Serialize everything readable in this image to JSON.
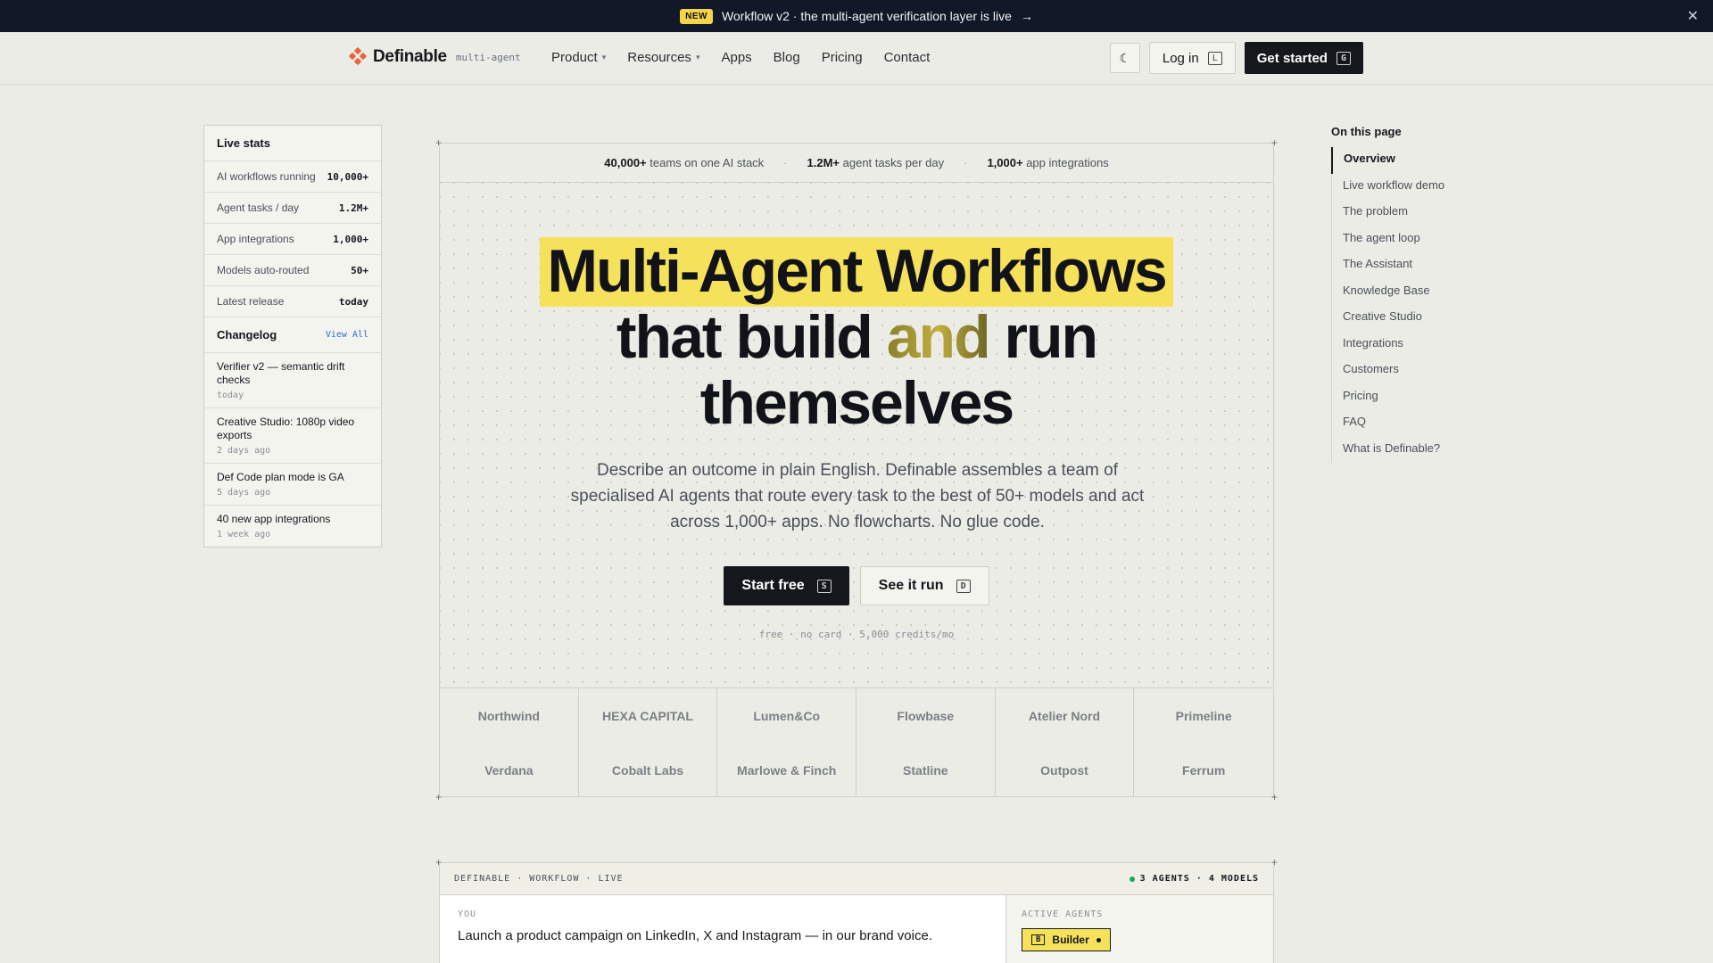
{
  "announcement": {
    "badge": "NEW",
    "text": "Workflow v2 · the multi-agent verification layer is live",
    "arrow": "→",
    "close": "✕"
  },
  "nav": {
    "brand": "Definable",
    "brand_sub": "multi-agent",
    "menu": [
      {
        "label": "Product",
        "dropdown": true
      },
      {
        "label": "Resources",
        "dropdown": true
      },
      {
        "label": "Apps"
      },
      {
        "label": "Blog"
      },
      {
        "label": "Pricing"
      },
      {
        "label": "Contact"
      }
    ],
    "theme_icon": "☾",
    "login": "Log in",
    "login_key": "L",
    "get_started": "Get started",
    "get_started_key": "G"
  },
  "stats": {
    "title": "Live stats",
    "rows": [
      {
        "label": "AI workflows running",
        "value": "10,000+"
      },
      {
        "label": "Agent tasks / day",
        "value": "1.2M+"
      },
      {
        "label": "App integrations",
        "value": "1,000+"
      },
      {
        "label": "Models auto-routed",
        "value": "50+"
      },
      {
        "label": "Latest release",
        "value": "today"
      }
    ],
    "changelog_title": "Changelog",
    "changelog_link": "View All",
    "changelog": [
      {
        "title": "Verifier v2 — semantic drift checks",
        "date": "today"
      },
      {
        "title": "Creative Studio: 1080p video exports",
        "date": "2 days ago"
      },
      {
        "title": "Def Code plan mode is GA",
        "date": "5 days ago"
      },
      {
        "title": "40 new app integrations",
        "date": "1 week ago"
      }
    ]
  },
  "toc": {
    "title": "On this page",
    "items": [
      "Overview",
      "Live workflow demo",
      "The problem",
      "The agent loop",
      "The Assistant",
      "Knowledge Base",
      "Creative Studio",
      "Integrations",
      "Customers",
      "Pricing",
      "FAQ",
      "What is Definable?"
    ]
  },
  "hero": {
    "statbar": [
      {
        "bold": "40,000+",
        "text": "teams on one AI stack"
      },
      {
        "bold": "1.2M+",
        "text": "agent tasks per day"
      },
      {
        "bold": "1,000+",
        "text": "app integrations"
      }
    ],
    "line1": "Multi-Agent Workflows",
    "line2_a": "that build ",
    "line2_and": "and",
    "line2_b": " run",
    "line3": "themselves",
    "description": "Describe an outcome in plain English. Definable assembles a team of specialised AI agents that route every task to the best of 50+ models and act across 1,000+ apps. No flowcharts. No glue code.",
    "cta_primary": "Start free",
    "cta_primary_key": "S",
    "cta_secondary": "See it run",
    "cta_secondary_key": "D",
    "fine_print": "free · no card · 5,000 credits/mo"
  },
  "logos": [
    "Northwind",
    "HEXA CAPITAL",
    "Lumen&Co",
    "Flowbase",
    "Atelier Nord",
    "Primeline",
    "Verdana",
    "Cobalt Labs",
    "Marlowe & Finch",
    "Statline",
    "Outpost",
    "Ferrum"
  ],
  "workflow": {
    "header_left": "DEFINABLE · WORKFLOW · LIVE",
    "header_right": "3 AGENTS · 4 MODELS",
    "you_label": "YOU",
    "prompt": "Launch a product campaign on LinkedIn, X and Instagram — in our brand voice.",
    "active_label": "ACTIVE AGENTS",
    "agent_key": "B",
    "agent_name": "Builder"
  }
}
